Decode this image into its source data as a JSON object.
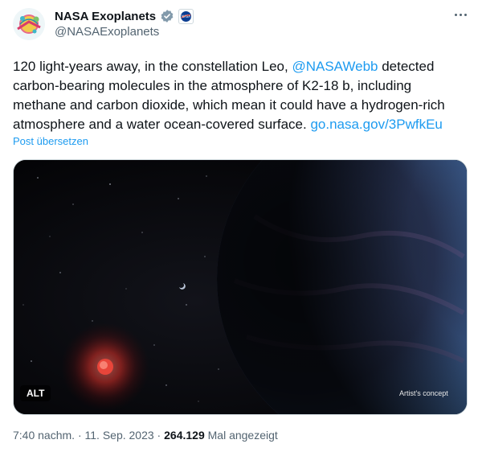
{
  "author": {
    "display_name": "NASA Exoplanets",
    "handle": "@NASAExoplanets",
    "verified_icon": "verified-badge-icon",
    "affiliation_icon": "nasa-logo-icon"
  },
  "tweet": {
    "text_before_mention": "120 light-years away, in the constellation Leo, ",
    "mention": "@NASAWebb",
    "text_after_mention": " detected carbon-bearing molecules in the atmosphere of K2-18 b, including methane and carbon dioxide, which mean it could have a hydrogen-rich atmosphere and a water ocean-covered surface. ",
    "link": "go.nasa.gov/3PwfkEu",
    "translate_label": "Post übersetzen"
  },
  "media": {
    "alt_label": "ALT",
    "caption": "Artist's concept"
  },
  "meta": {
    "time": "7:40 nachm.",
    "separator": " · ",
    "date": "11. Sep. 2023",
    "views": "264.129",
    "views_label": " Mal angezeigt"
  },
  "colors": {
    "link": "#1d9bf0",
    "secondary_text": "#536471",
    "verified": "#829aab"
  }
}
